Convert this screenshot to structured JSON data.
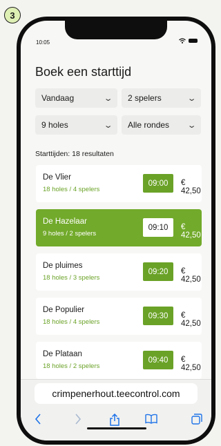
{
  "step_number": "3",
  "status_bar": {
    "time": "10:05"
  },
  "title": "Boek een starttijd",
  "filters": {
    "day": "Vandaag",
    "players": "2 spelers",
    "holes": "9 holes",
    "rounds": "Alle rondes"
  },
  "results_text": "Starttijden: 18 resultaten",
  "tee_times": [
    {
      "course": "De Vlier",
      "details": "18 holes / 4 spelers",
      "time": "09:00",
      "price": "€ 42,50",
      "selected": false
    },
    {
      "course": "De Hazelaar",
      "details": "9 holes / 2 spelers",
      "time": "09:10",
      "price": "€ 42,50",
      "selected": true
    },
    {
      "course": "De pluimes",
      "details": "18 holes / 3 spelers",
      "time": "09:20",
      "price": "€ 42,50",
      "selected": false
    },
    {
      "course": "De Populier",
      "details": "18 holes / 4 spelers",
      "time": "09:30",
      "price": "€ 42,50",
      "selected": false
    },
    {
      "course": "De Plataan",
      "details": "18 holes / 2 spelers",
      "time": "09:40",
      "price": "€ 42,50",
      "selected": false
    }
  ],
  "browser": {
    "url": "crimpenerhout.teecontrol.com"
  },
  "colors": {
    "accent_green": "#72aa2b",
    "step_badge": "#dff0b4"
  },
  "icons": {
    "toolbar": [
      "back-icon",
      "forward-icon",
      "share-icon",
      "bookmarks-icon",
      "tabs-icon"
    ],
    "status": [
      "wifi-icon",
      "battery-icon"
    ]
  }
}
